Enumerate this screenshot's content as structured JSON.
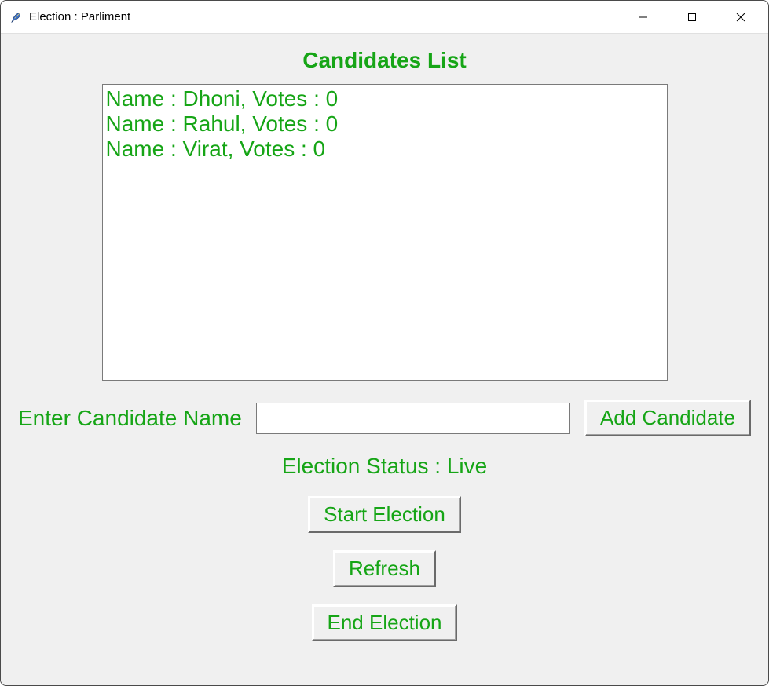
{
  "window": {
    "title": "Election : Parliment"
  },
  "heading": "Candidates List",
  "candidates": [
    {
      "line": "Name : Dhoni, Votes : 0"
    },
    {
      "line": "Name : Rahul, Votes : 0"
    },
    {
      "line": "Name : Virat, Votes : 0"
    }
  ],
  "form": {
    "label": "Enter Candidate Name",
    "input_value": "",
    "add_label": "Add Candidate"
  },
  "status": "Election Status : Live",
  "buttons": {
    "start": "Start Election",
    "refresh": "Refresh",
    "end": "End Election"
  },
  "colors": {
    "accent": "#16a516",
    "client_bg": "#f0f0f0"
  }
}
